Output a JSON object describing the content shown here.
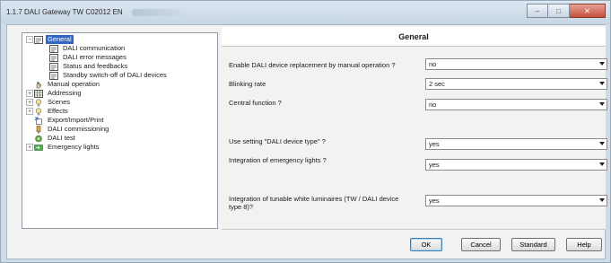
{
  "window": {
    "title": "1.1.7 DALI Gateway TW C02012 EN",
    "controls": {
      "minimize": "–",
      "maximize": "□",
      "close": "✕"
    }
  },
  "tree": {
    "items": [
      {
        "label": "General",
        "level": 0,
        "expander": "−",
        "icon": "general-settings-icon",
        "selected": true
      },
      {
        "label": "DALI communication",
        "level": 1,
        "expander": "",
        "icon": "settings-page-icon",
        "selected": false
      },
      {
        "label": "DALI error messages",
        "level": 1,
        "expander": "",
        "icon": "settings-page-icon",
        "selected": false
      },
      {
        "label": "Status and feedbacks",
        "level": 1,
        "expander": "",
        "icon": "settings-page-icon",
        "selected": false
      },
      {
        "label": "Standby switch-off of DALI devices",
        "level": 1,
        "expander": "",
        "icon": "settings-page-icon",
        "selected": false
      },
      {
        "label": "Manual operation",
        "level": 0,
        "expander": "",
        "icon": "hand-operation-icon",
        "selected": false
      },
      {
        "label": "Addressing",
        "level": 0,
        "expander": "+",
        "icon": "grid-address-icon",
        "selected": false
      },
      {
        "label": "Scenes",
        "level": 0,
        "expander": "+",
        "icon": "lamp-icon",
        "selected": false
      },
      {
        "label": "Effects",
        "level": 0,
        "expander": "+",
        "icon": "lamp-icon",
        "selected": false
      },
      {
        "label": "Export/Import/Print",
        "level": 0,
        "expander": "",
        "icon": "export-icon",
        "selected": false
      },
      {
        "label": "DALI commissioning",
        "level": 0,
        "expander": "",
        "icon": "commissioning-icon",
        "selected": false
      },
      {
        "label": "DALI test",
        "level": 0,
        "expander": "",
        "icon": "test-icon",
        "selected": false
      },
      {
        "label": "Emergency lights",
        "level": 0,
        "expander": "+",
        "icon": "emergency-light-icon",
        "selected": false
      }
    ]
  },
  "panel": {
    "title": "General",
    "params": [
      {
        "label": "Enable DALI device replacement by manual operation ?",
        "value": "no"
      },
      {
        "label": "Blinking rate",
        "value": "2 sec"
      },
      {
        "label": "Central function ?",
        "value": "no"
      },
      {
        "label": "Use setting \"DALI device type\" ?",
        "value": "yes"
      },
      {
        "label": "Integration of emergency lights ?",
        "value": "yes"
      },
      {
        "label": "Integration of tunable white luminaires (TW / DALI device type 8)?",
        "value": "yes"
      }
    ]
  },
  "buttons": {
    "ok": "OK",
    "cancel": "Cancel",
    "standard": "Standard",
    "help": "Help"
  },
  "colors": {
    "selection": "#3166c4",
    "frame": "#cfdbe7",
    "close": "#c4503d"
  }
}
